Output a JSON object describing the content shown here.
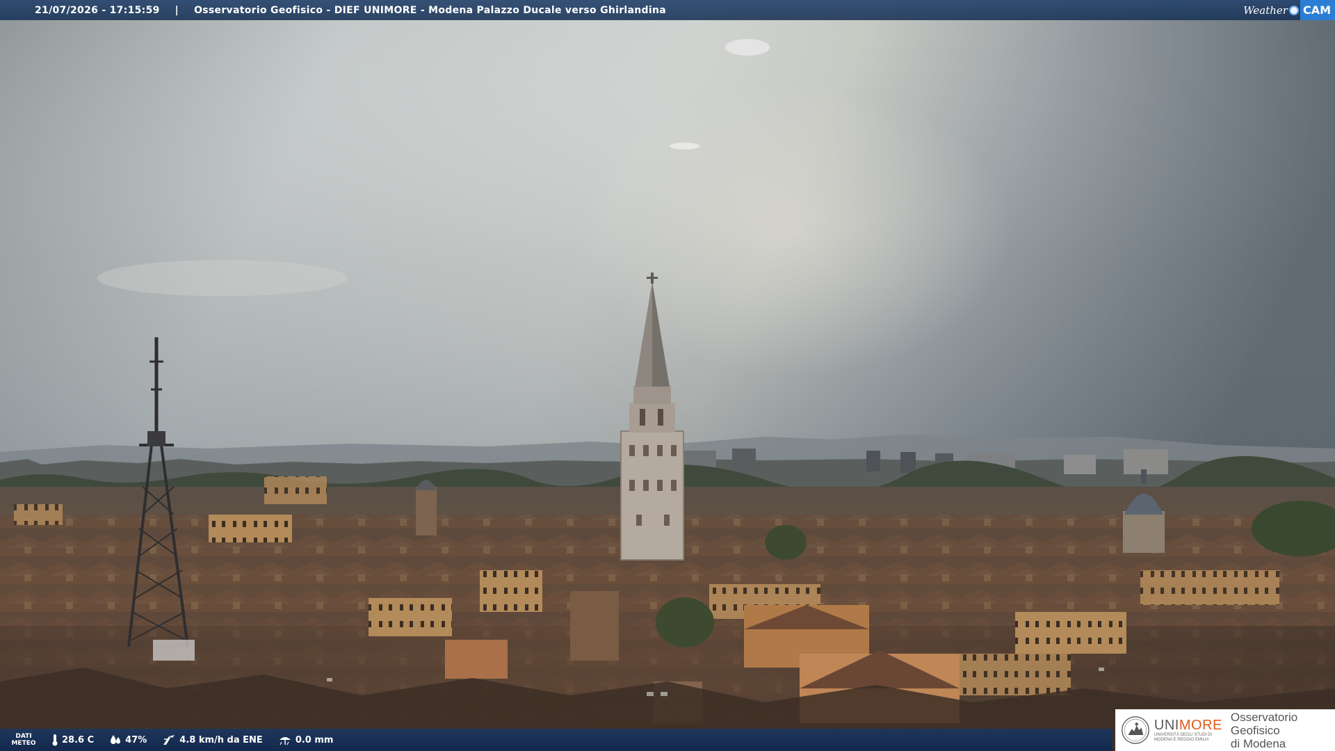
{
  "topbar": {
    "datetime": "21/07/2026 - 17:15:59",
    "separator": "|",
    "title": "Osservatorio Geofisico - DIEF UNIMORE - Modena Palazzo Ducale verso Ghirlandina"
  },
  "brand": {
    "weather": "Weather",
    "cam": "CAM",
    "accent_color": "#2a7fd4"
  },
  "weather_bar": {
    "label_line1": "DATI",
    "label_line2": "METEO",
    "temperature": "28.6 C",
    "humidity": "47%",
    "wind": "4.8 km/h da ENE",
    "rain": "0.0 mm",
    "icons": [
      "thermometer-icon",
      "humidity-drop-icon",
      "wind-icon",
      "rain-gauge-icon"
    ]
  },
  "logo": {
    "uni_part1": "UNI",
    "uni_part2": "MORE",
    "uni_subtitle": "UNIVERSITÀ DEGLI STUDI DI MODENA E REGGIO EMILIA",
    "observatory_line1": "Osservatorio Geofisico",
    "observatory_line2": "di Modena",
    "accent_color": "#e05a1c"
  }
}
